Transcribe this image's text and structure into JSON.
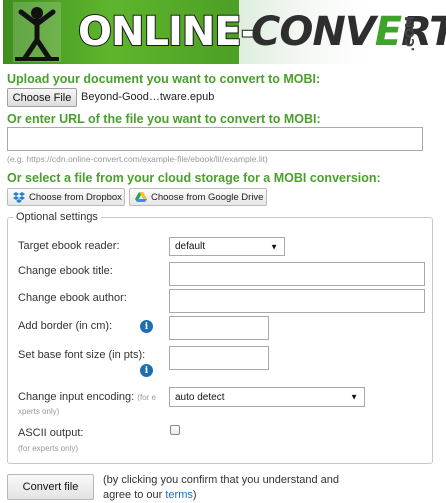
{
  "header": {
    "logo_online": "ONLINE-",
    "logo_convert_pre": "CONV",
    "logo_convert_mid": "E",
    "logo_convert_post": "RT",
    "logo_com": ".COM"
  },
  "upload": {
    "title": "Upload your document you want to convert to MOBI:",
    "choose_file_label": "Choose File",
    "selected_file": "Beyond-Good…tware.epub"
  },
  "url": {
    "title": "Or enter URL of the file you want to convert to MOBI:",
    "value": "",
    "example": "(e.g. https://cdn.online-convert.com/example-file/ebook/lit/example.lit)"
  },
  "cloud": {
    "title": "Or select a file from your cloud storage for a MOBI conversion:",
    "dropbox_label": "Choose from Dropbox",
    "gdrive_label": "Choose from Google Drive"
  },
  "settings": {
    "legend": "Optional settings",
    "target_reader_label": "Target ebook reader:",
    "target_reader_value": "default",
    "title_label": "Change ebook title:",
    "title_value": "",
    "author_label": "Change ebook author:",
    "author_value": "",
    "border_label": "Add border (in cm):",
    "border_value": "",
    "font_size_label": "Set base font size (in pts):",
    "font_size_value": "",
    "encoding_label": "Change input encoding:",
    "encoding_hint_a": "(for e",
    "encoding_hint_b": "xperts only)",
    "encoding_value": "auto detect",
    "ascii_label": "ASCII output:",
    "ascii_hint": "(for experts only)",
    "ascii_checked": false,
    "info_glyph": "i"
  },
  "footer": {
    "convert_label": "Convert file",
    "confirm_text": "(by clicking you confirm that you understand and agree to our ",
    "terms_label": "terms",
    "confirm_end": ")"
  },
  "colors": {
    "accent_green": "#4aa02c",
    "info_blue": "#1e6eb5",
    "link_blue": "#2a6db5"
  },
  "icons": [
    "person-logo-icon",
    "dropbox-icon",
    "google-drive-icon",
    "info-icon",
    "select-arrow-icon"
  ]
}
